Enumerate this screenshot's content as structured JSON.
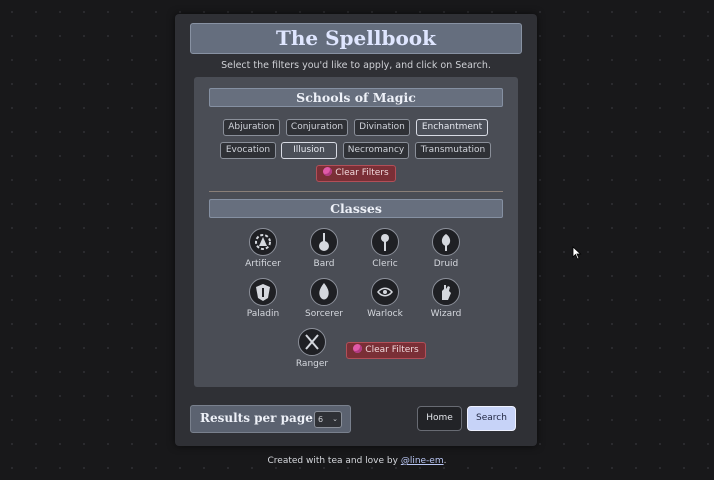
{
  "title": "The Spellbook",
  "subtitle": "Select the filters you'd like to apply, and click on Search.",
  "schools": {
    "heading": "Schools of Magic",
    "items": [
      {
        "label": "Abjuration",
        "active": false
      },
      {
        "label": "Conjuration",
        "active": false
      },
      {
        "label": "Divination",
        "active": false
      },
      {
        "label": "Enchantment",
        "active": true
      },
      {
        "label": "Evocation",
        "active": false
      },
      {
        "label": "Illusion",
        "active": true
      },
      {
        "label": "Necromancy",
        "active": false
      },
      {
        "label": "Transmutation",
        "active": false
      }
    ],
    "clear_label": "Clear Filters"
  },
  "classes": {
    "heading": "Classes",
    "items": [
      {
        "label": "Artificer",
        "icon": "artificer-gear-icon"
      },
      {
        "label": "Bard",
        "icon": "bard-lute-icon"
      },
      {
        "label": "Cleric",
        "icon": "cleric-mace-icon"
      },
      {
        "label": "Druid",
        "icon": "druid-leaf-icon"
      },
      {
        "label": "Paladin",
        "icon": "paladin-helm-icon"
      },
      {
        "label": "Sorcerer",
        "icon": "sorcerer-flame-icon"
      },
      {
        "label": "Warlock",
        "icon": "warlock-eye-icon"
      },
      {
        "label": "Wizard",
        "icon": "wizard-hand-icon"
      },
      {
        "label": "Ranger",
        "icon": "ranger-bow-icon"
      }
    ],
    "clear_label": "Clear Filters"
  },
  "results": {
    "label": "Results per page",
    "value": "6"
  },
  "buttons": {
    "home": "Home",
    "search": "Search"
  },
  "footer": {
    "text": "Created with tea and love by ",
    "link": "@line-em",
    "end": "."
  },
  "colors": {
    "accent": "#c7d3f8",
    "clear": "#7a2f36",
    "gem": "#e05aa9"
  }
}
